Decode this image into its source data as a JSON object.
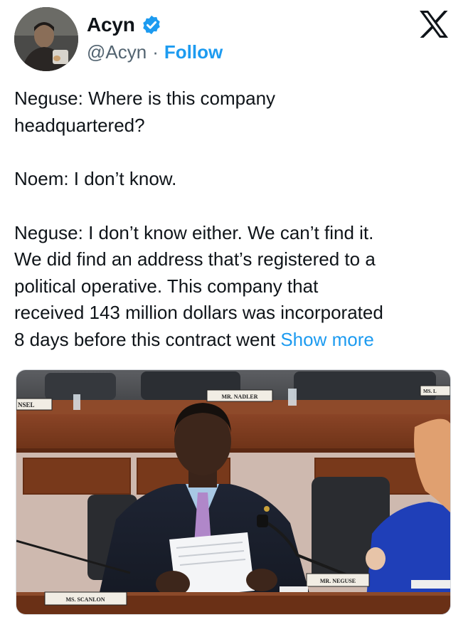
{
  "author": {
    "display_name": "Acyn",
    "handle": "@Acyn",
    "separator": "·",
    "follow_label": "Follow",
    "verified": true,
    "avatar_alt": "profile-photo"
  },
  "platform_icon": "x-logo-icon",
  "tweet": {
    "paragraphs": [
      "Neguse: Where is this company headquartered?",
      "Noem: I don’t know.",
      "Neguse: I don’t know either. We can’t find it. We did find an address that’s registered to a political operative. This company that received 143 million dollars was incorporated 8 days before this contract went"
    ],
    "line1": "Neguse: Where is this company",
    "line2": "headquartered?",
    "line3": "Noem: I don’t know.",
    "line4": "Neguse: I don’t know either. We can’t find it.",
    "line5": "We did find an address that’s registered to a",
    "line6": "political operative. This company that",
    "line7": "received 143 million dollars was incorporated",
    "line8": "8 days before this contract went",
    "show_more_label": "Show more"
  },
  "media": {
    "kind": "video-frame",
    "nameplates": {
      "left_edge": "NSEL",
      "nadler": "MR. NADLER",
      "right_edge": "MS. L",
      "scanlon": "MS. SCANLON",
      "neguse": "MR. NEGUSE"
    }
  },
  "colors": {
    "link_blue": "#1d9bf0",
    "text": "#0f1419",
    "secondary_text": "#536471",
    "wood": "#7a3a1e"
  }
}
